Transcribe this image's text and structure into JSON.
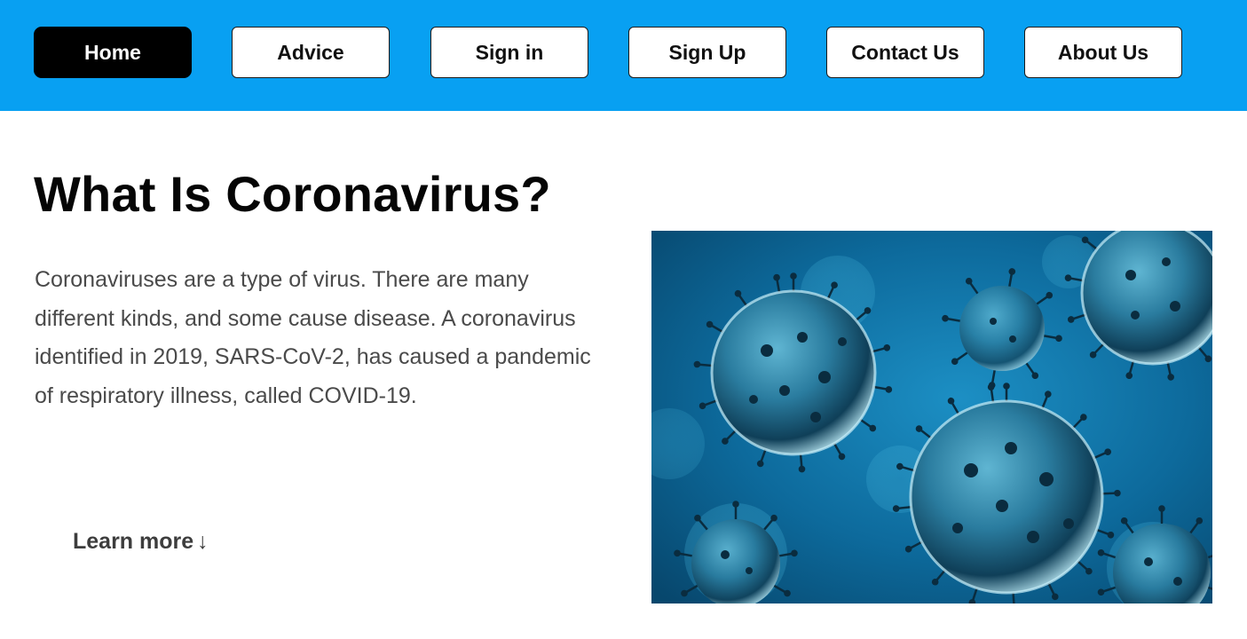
{
  "nav": {
    "items": [
      {
        "label": "Home",
        "active": true
      },
      {
        "label": "Advice",
        "active": false
      },
      {
        "label": "Sign in",
        "active": false
      },
      {
        "label": "Sign Up",
        "active": false
      },
      {
        "label": "Contact Us",
        "active": false
      },
      {
        "label": "About Us",
        "active": false
      }
    ]
  },
  "main": {
    "title": "What Is Coronavirus?",
    "description": "Coronaviruses are a type of virus. There are many different kinds, and some cause disease. A coronavirus identified in 2019, SARS-CoV-2, has caused a pandemic of respiratory illness, called COVID-19.",
    "learn_more": "Learn more",
    "learn_more_icon": "↓"
  },
  "colors": {
    "header_bg": "#08a0f2",
    "active_button_bg": "#000000",
    "image_bg": "#0a5f8e"
  },
  "hero_image": {
    "subject": "coronavirus-illustration"
  }
}
